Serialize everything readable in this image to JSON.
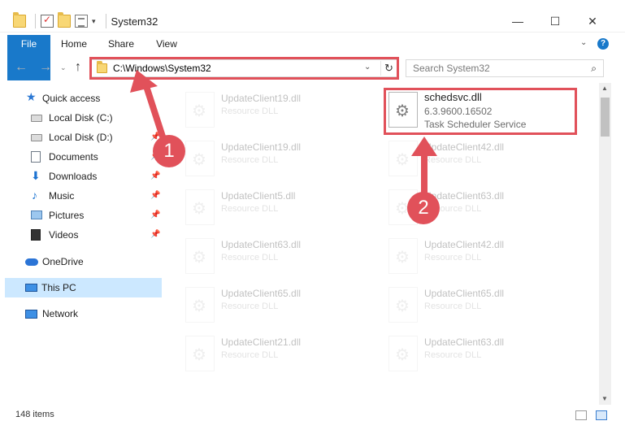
{
  "window": {
    "title": "System32",
    "minimize": "—",
    "maximize": "☐",
    "close": "✕"
  },
  "ribbon": {
    "tabs": [
      "File",
      "Home",
      "Share",
      "View"
    ],
    "help": "?"
  },
  "address_bar": {
    "path": "C:\\Windows\\System32",
    "search_placeholder": "Search System32"
  },
  "sidebar": {
    "items": [
      {
        "label": "Quick access",
        "icon": "star-icon"
      },
      {
        "label": "Local Disk (C:)",
        "icon": "drive-icon"
      },
      {
        "label": "Local Disk (D:)",
        "icon": "drive-icon"
      },
      {
        "label": "Documents",
        "icon": "documents-icon"
      },
      {
        "label": "Downloads",
        "icon": "download-icon"
      },
      {
        "label": "Music",
        "icon": "music-icon"
      },
      {
        "label": "Pictures",
        "icon": "pictures-icon"
      },
      {
        "label": "Videos",
        "icon": "video-icon"
      },
      {
        "label": "OneDrive",
        "icon": "cloud-icon"
      },
      {
        "label": "This PC",
        "icon": "computer-icon"
      },
      {
        "label": "Network",
        "icon": "network-icon"
      }
    ]
  },
  "files": {
    "main": {
      "name": "schedsvc.dll",
      "version": "6.3.9600.16502",
      "description": "Task Scheduler Service"
    },
    "left": [
      {
        "name": "UpdateClient19.dll",
        "type": "Resource DLL"
      },
      {
        "name": "UpdateClient19.dll",
        "type": "Resource DLL"
      },
      {
        "name": "UpdateClient5.dll",
        "type": "Resource DLL"
      },
      {
        "name": "UpdateClient63.dll",
        "type": "Resource DLL"
      },
      {
        "name": "UpdateClient65.dll",
        "type": "Resource DLL"
      },
      {
        "name": "UpdateClient21.dll",
        "type": "Resource DLL"
      }
    ],
    "right": [
      {
        "name": "UpdateClient42.dll",
        "type": "Resource DLL"
      },
      {
        "name": "UpdateClient63.dll",
        "type": "Resource DLL"
      },
      {
        "name": "UpdateClient42.dll",
        "type": "Resource DLL"
      },
      {
        "name": "UpdateClient65.dll",
        "type": "Resource DLL"
      },
      {
        "name": "UpdateClient63.dll",
        "type": "Resource DLL"
      }
    ]
  },
  "annotations": {
    "step1": "1",
    "step2": "2",
    "color": "#e1515a"
  },
  "status": {
    "items": "148 items"
  }
}
